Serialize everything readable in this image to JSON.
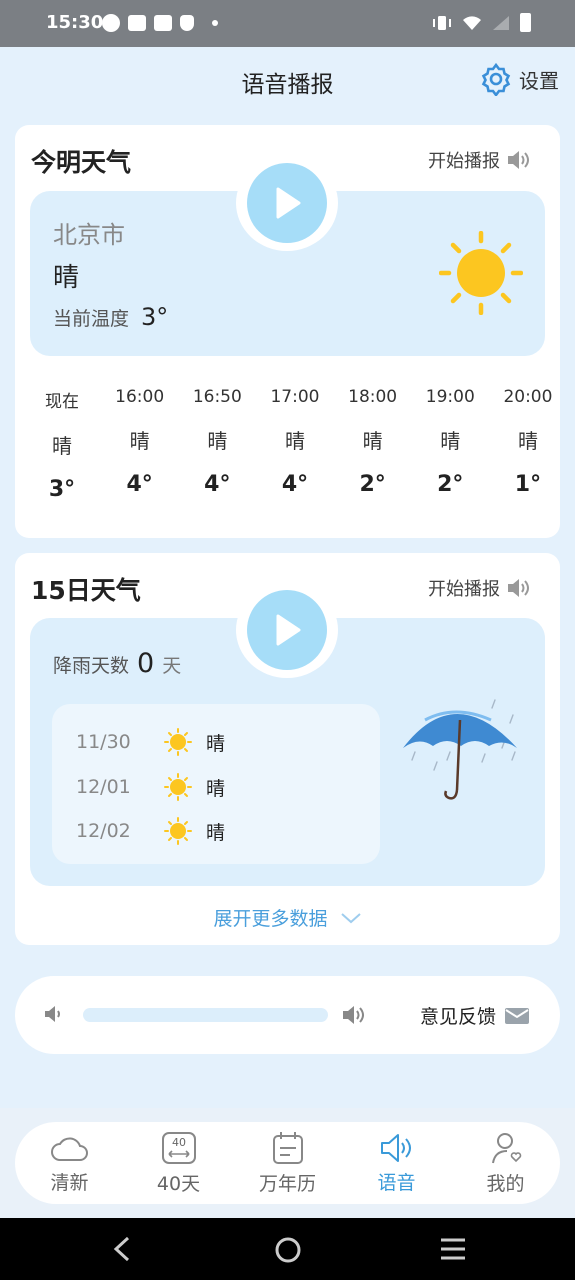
{
  "status_bar": {
    "time": "15:30"
  },
  "header": {
    "title": "语音播报",
    "settings_label": "设置"
  },
  "today": {
    "title": "今明天气",
    "start_label": "开始播报",
    "city": "北京市",
    "condition": "晴",
    "current_temp_label": "当前温度",
    "current_temp": "3°",
    "hourly": [
      {
        "time": "现在",
        "condition": "晴",
        "temp": "3°"
      },
      {
        "time": "16:00",
        "condition": "晴",
        "temp": "4°"
      },
      {
        "time": "16:50",
        "condition": "晴",
        "temp": "4°"
      },
      {
        "time": "17:00",
        "condition": "晴",
        "temp": "4°"
      },
      {
        "time": "18:00",
        "condition": "晴",
        "temp": "2°"
      },
      {
        "time": "19:00",
        "condition": "晴",
        "temp": "2°"
      },
      {
        "time": "20:00",
        "condition": "晴",
        "temp": "1°"
      }
    ]
  },
  "fifteen": {
    "title": "15日天气",
    "start_label": "开始播报",
    "rain_label": "降雨天数",
    "rain_days": "0",
    "rain_unit": "天",
    "days": [
      {
        "date": "11/30",
        "condition": "晴"
      },
      {
        "date": "12/01",
        "condition": "晴"
      },
      {
        "date": "12/02",
        "condition": "晴"
      }
    ],
    "expand_label": "展开更多数据"
  },
  "audio": {
    "feedback_label": "意见反馈",
    "volume": 0
  },
  "nav": {
    "items": [
      {
        "label": "清新"
      },
      {
        "label": "40天",
        "icon_text": "40"
      },
      {
        "label": "万年历"
      },
      {
        "label": "语音"
      },
      {
        "label": "我的"
      }
    ],
    "active": "语音"
  },
  "colors": {
    "accent": "#3a9ad9",
    "sun": "#fcc620",
    "play": "#a6ddf8",
    "background": "#e4f1fc"
  }
}
